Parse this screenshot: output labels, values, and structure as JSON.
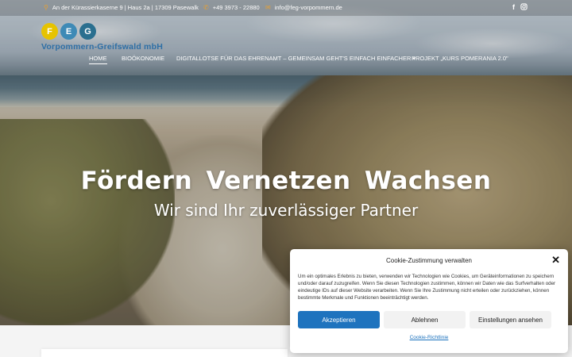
{
  "topbar": {
    "address": "An der Kürassierkaserne 9 | Haus 2a | 17309 Pasewalk",
    "phone": "+49 3973 - 22880",
    "email": "info@feg-vorpommern.de",
    "address_icon": "map-pin-icon",
    "phone_icon": "phone-icon",
    "email_icon": "envelope-icon",
    "social": [
      "facebook-icon",
      "instagram-icon"
    ]
  },
  "logo": {
    "letters": [
      "F",
      "E",
      "G"
    ],
    "name": "Vorpommern-Greifswald mbH",
    "colors": [
      "#e6c300",
      "#3e8ab6",
      "#2a6f8f"
    ]
  },
  "nav": {
    "items": [
      {
        "label": "HOME",
        "active": true
      },
      {
        "label": "BIOÖKONOMIE"
      },
      {
        "label": "DIGITALLOTSE FÜR DAS EHRENAMT – GEMEINSAM GEHT'S EINFACH EINFACHER",
        "has_dropdown": true
      },
      {
        "label": "PROJEKT „KURS POMERANIA 2.0\""
      }
    ]
  },
  "hero": {
    "headline": "Fördern  Vernetzen  Wachsen",
    "subline": "Wir sind Ihr zuverlässiger Partner"
  },
  "cookie": {
    "title": "Cookie-Zustimmung verwalten",
    "text": "Um ein optimales Erlebnis zu bieten, verwenden wir Technologien wie Cookies, um Geräteinformationen zu speichern und/oder darauf zuzugreifen. Wenn Sie diesen Technologien zustimmen, können wir Daten wie das Surfverhalten oder eindeutige IDs auf dieser Website verarbeiten. Wenn Sie Ihre Zustimmung nicht erteilen oder zurückziehen, können bestimmte Merkmale und Funktionen beeinträchtigt werden.",
    "accept_label": "Akzeptieren",
    "deny_label": "Ablehnen",
    "prefs_label": "Einstellungen ansehen",
    "policy_label": "Cookie-Richtlinie",
    "accent": "#1e73be"
  }
}
